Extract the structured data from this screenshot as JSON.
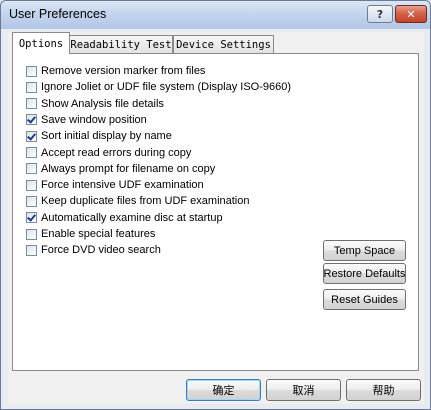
{
  "window": {
    "title": "User Preferences",
    "help_label": "?",
    "close_label": "✕"
  },
  "tabs": [
    {
      "label": "Options",
      "active": true
    },
    {
      "label": "Readability Test",
      "active": false
    },
    {
      "label": "Device Settings",
      "active": false
    }
  ],
  "options": [
    {
      "label": "Remove version marker from files",
      "checked": false
    },
    {
      "label": "Ignore Joliet or UDF file system (Display ISO-9660)",
      "checked": false
    },
    {
      "label": "Show Analysis file details",
      "checked": false
    },
    {
      "label": "Save window position",
      "checked": true
    },
    {
      "label": "Sort initial display by name",
      "checked": true
    },
    {
      "label": "Accept read errors during copy",
      "checked": false
    },
    {
      "label": "Always prompt for filename on copy",
      "checked": false
    },
    {
      "label": "Force intensive UDF examination",
      "checked": false
    },
    {
      "label": "Keep duplicate files from UDF examination",
      "checked": false
    },
    {
      "label": "Automatically examine disc at startup",
      "checked": true
    },
    {
      "label": "Enable special features",
      "checked": false
    },
    {
      "label": "Force DVD video search",
      "checked": false
    }
  ],
  "side_buttons": {
    "temp_space": "Temp Space",
    "restore_defaults": "Restore Defaults",
    "reset_guides": "Reset Guides"
  },
  "footer": {
    "ok": "确定",
    "cancel": "取消",
    "help": "帮助"
  }
}
